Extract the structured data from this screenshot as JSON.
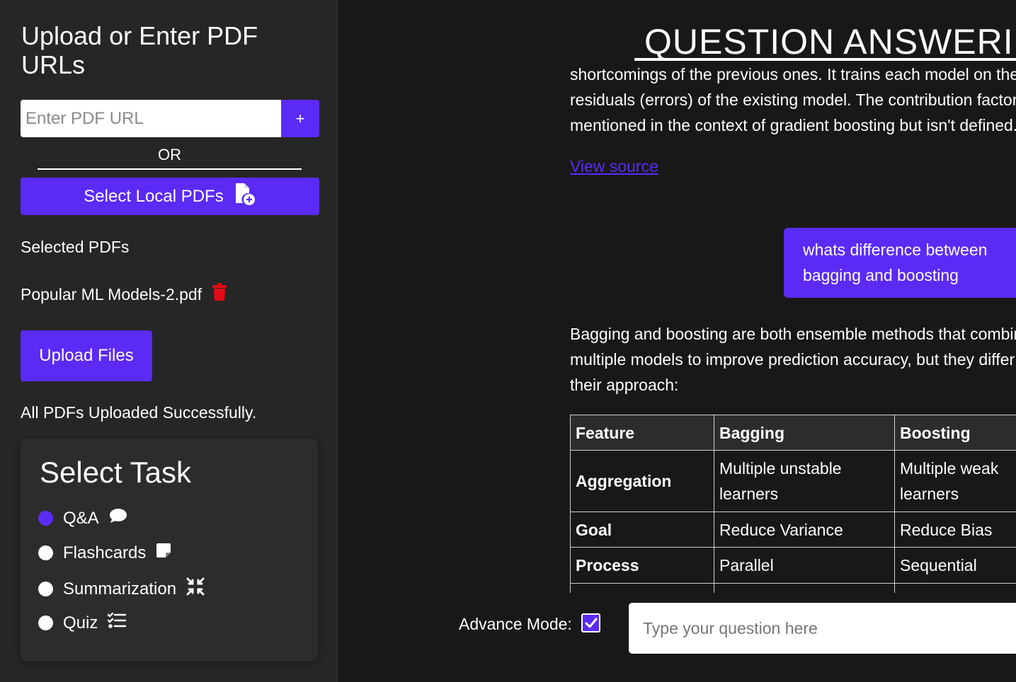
{
  "sidebar": {
    "title": "Upload or Enter PDF URLs",
    "url_placeholder": "Enter PDF URL",
    "add_label": "+",
    "or_label": "OR",
    "select_local_label": "Select Local PDFs",
    "selected_title": "Selected PDFs",
    "files": [
      {
        "name": "Popular ML Models-2.pdf"
      }
    ],
    "upload_label": "Upload Files",
    "status": "All PDFs Uploaded Successfully."
  },
  "task": {
    "title": "Select Task",
    "options": [
      {
        "label": "Q&A",
        "icon": "chat-bubble-icon",
        "selected": true
      },
      {
        "label": "Flashcards",
        "icon": "sticky-note-icon",
        "selected": false
      },
      {
        "label": "Summarization",
        "icon": "compress-icon",
        "selected": false
      },
      {
        "label": "Quiz",
        "icon": "checklist-icon",
        "selected": false
      }
    ]
  },
  "main": {
    "heading": "QUESTION ANSWERING",
    "answer1_lines": [
      "shortcomings of the previous ones. It trains each model on the",
      "residuals (errors) of the existing model. The contribution factor is",
      "mentioned in the context of gradient boosting but isn't defined."
    ],
    "view_source": "View source",
    "user_question": "whats difference between bagging and boosting",
    "answer2_lines": [
      "Bagging and boosting are both ensemble methods that combine",
      "multiple models to improve prediction accuracy, but they differ in",
      "their approach:"
    ],
    "table": {
      "headers": [
        "Feature",
        "Bagging",
        "Boosting"
      ],
      "rows": [
        [
          "Aggregation",
          "Multiple unstable learners",
          "Multiple weak learners"
        ],
        [
          "Goal",
          "Reduce Variance",
          "Reduce Bias"
        ],
        [
          "Process",
          "Parallel",
          "Sequential"
        ],
        [
          "",
          "",
          ""
        ]
      ]
    }
  },
  "footer": {
    "advance_mode_label": "Advance Mode:",
    "advance_mode_checked": true,
    "question_placeholder": "Type your question here"
  },
  "colors": {
    "accent": "#5b2bf5",
    "sidebar_bg": "#262626",
    "main_bg": "#181818",
    "delete": "#e50914"
  }
}
